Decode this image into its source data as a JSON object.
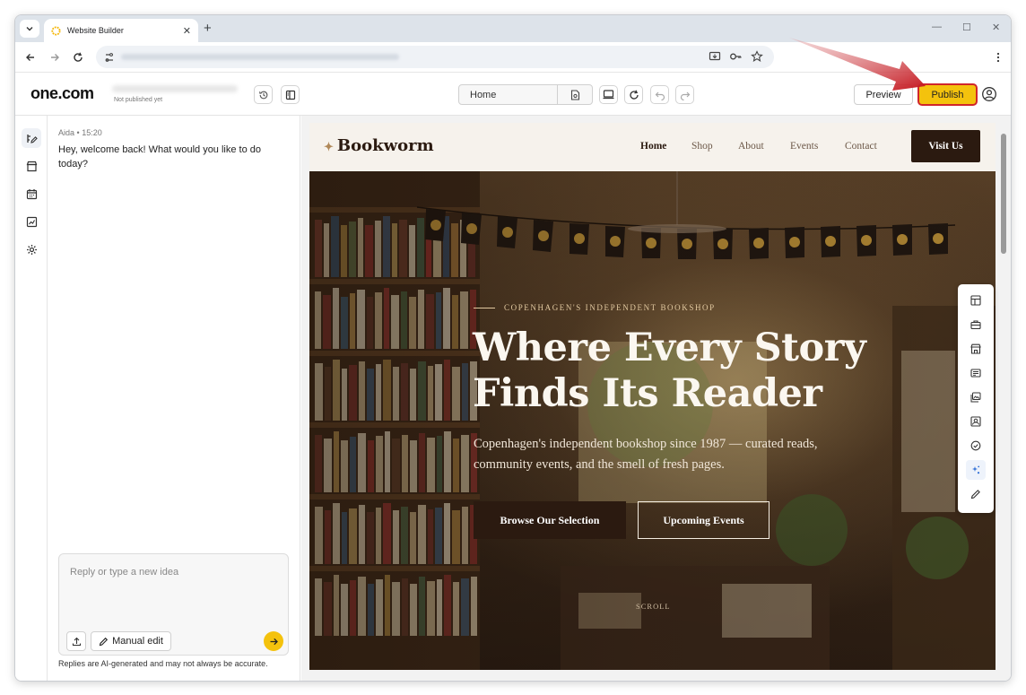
{
  "browser": {
    "tab_title": "Website Builder",
    "new_tab": "+"
  },
  "app": {
    "brand": "one.com",
    "site_status": "Not published yet",
    "page_selector": "Home",
    "preview_label": "Preview",
    "publish_label": "Publish",
    "accent": "#f4c20d"
  },
  "chat": {
    "author": "Aida",
    "time": "15:20",
    "message": "Hey, welcome back! What would you like to do today?",
    "input_placeholder": "Reply or type a new idea",
    "manual_edit_label": "Manual edit",
    "disclaimer": "Replies are AI-generated and may not always be accurate."
  },
  "site": {
    "logo": "Bookworm",
    "logo_icon": "✦",
    "nav": [
      "Home",
      "Shop",
      "About",
      "Events",
      "Contact"
    ],
    "visit_label": "Visit Us",
    "eyebrow": "COPENHAGEN'S INDEPENDENT BOOKSHOP",
    "headline": "Where Every Story Finds Its Reader",
    "subtext": "Copenhagen's independent bookshop since 1987 — curated reads, community events, and the smell of fresh pages.",
    "primary_cta": "Browse Our Selection",
    "secondary_cta": "Upcoming Events",
    "scroll": "SCROLL",
    "brand_color": "#2b1a10"
  },
  "icons": {
    "rail": [
      "edit-icon",
      "store-icon",
      "calendar-icon",
      "analytics-icon",
      "settings-icon"
    ],
    "tools": [
      "layout-icon",
      "briefcase-icon",
      "store-icon",
      "text-block-icon",
      "image-gallery-icon",
      "image-icon",
      "checkmark-icon",
      "ai-sparkle-icon",
      "pencil-icon"
    ]
  }
}
